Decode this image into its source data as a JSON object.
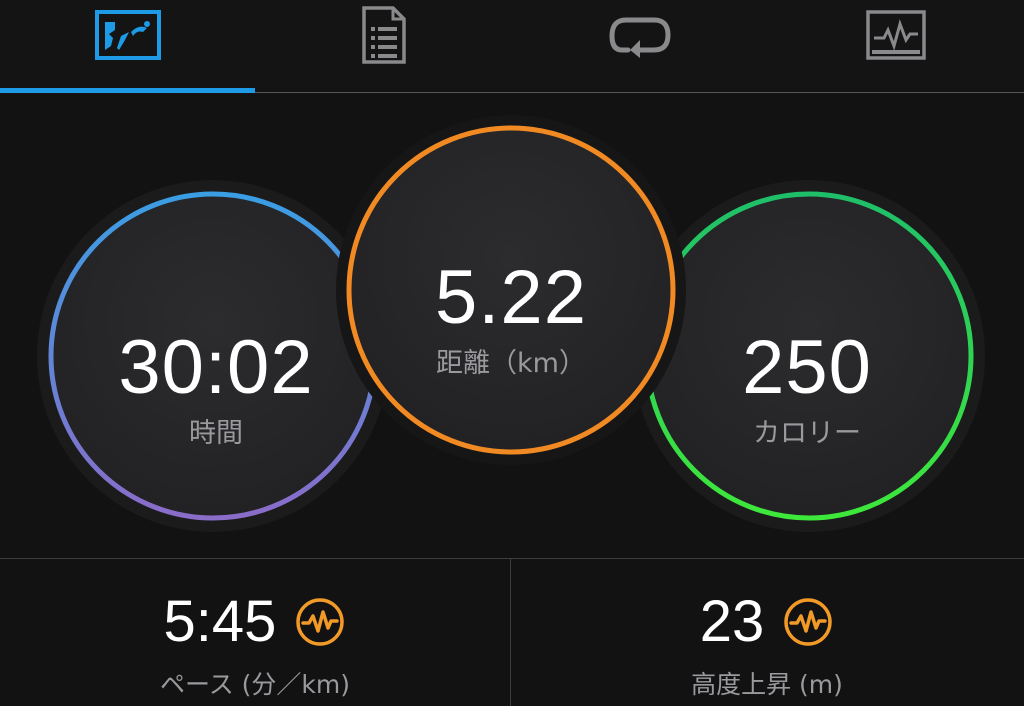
{
  "tabs": [
    {
      "icon": "summary-icon",
      "active": true
    },
    {
      "icon": "details-list-icon",
      "active": false
    },
    {
      "icon": "laps-icon",
      "active": false
    },
    {
      "icon": "graph-icon",
      "active": false
    }
  ],
  "circles": {
    "time": {
      "value": "30:02",
      "label": "時間",
      "color_start": "#3a9ee4",
      "color_end": "#8a6cc9"
    },
    "distance": {
      "value": "5.22",
      "label": "距離（km）",
      "color": "#f28a24"
    },
    "calories": {
      "value": "250",
      "label": "カロリー",
      "color_start": "#1fbf6a",
      "color_end": "#3ee83a"
    }
  },
  "stats": {
    "pace": {
      "value": "5:45",
      "label": "ペース (分／km)",
      "icon": "heart-rate-chart-icon"
    },
    "elevation": {
      "value": "23",
      "label": "高度上昇 (m)",
      "icon": "heart-rate-chart-icon"
    }
  },
  "colors": {
    "accent": "#1e9be6",
    "stat_icon": "#f19a28",
    "background": "#121213"
  }
}
